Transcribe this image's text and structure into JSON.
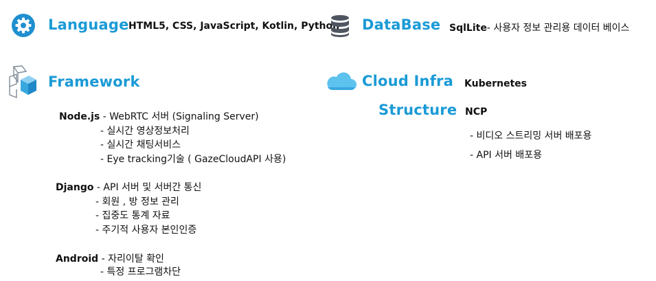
{
  "language": {
    "heading": "Language",
    "value": "HTML5, CSS, JavaScript, Kotlin, Python"
  },
  "database": {
    "heading": "DataBase",
    "value_bold": "SqlLite",
    "value_rest": "- 사용자 정보 관리용 데이터 베이스"
  },
  "framework": {
    "heading": "Framework",
    "nodejs": {
      "label": "Node.js",
      "first": " - WebRTC 서버 (Signaling Server)",
      "items": [
        "- 실시간 영상정보처리",
        "- 실시간 채팅서비스",
        "- Eye tracking기술 ( GazeCloudAPI 사용)"
      ]
    },
    "django": {
      "label": "Django",
      "first": " - API 서버 및 서버간 통신",
      "items": [
        "- 회원 , 방 정보 관리",
        "- 집중도 통계 자료",
        "- 주기적 사용자 본인인증"
      ]
    },
    "android": {
      "label": "Android",
      "first": " - 자리이탈 확인",
      "items": [
        "- 특정 프로그램차단"
      ]
    }
  },
  "cloud": {
    "heading_line1": "Cloud Infra",
    "heading_line2": "Structure",
    "value1": "Kubernetes",
    "value2": "NCP",
    "items": [
      "- 비디오 스트리밍 서버 배포용",
      "- API 서버 배포용"
    ]
  },
  "colors": {
    "accent": "#1a9ad6",
    "icon_blue": "#1f8fd0",
    "db_gray": "#4f5560"
  }
}
